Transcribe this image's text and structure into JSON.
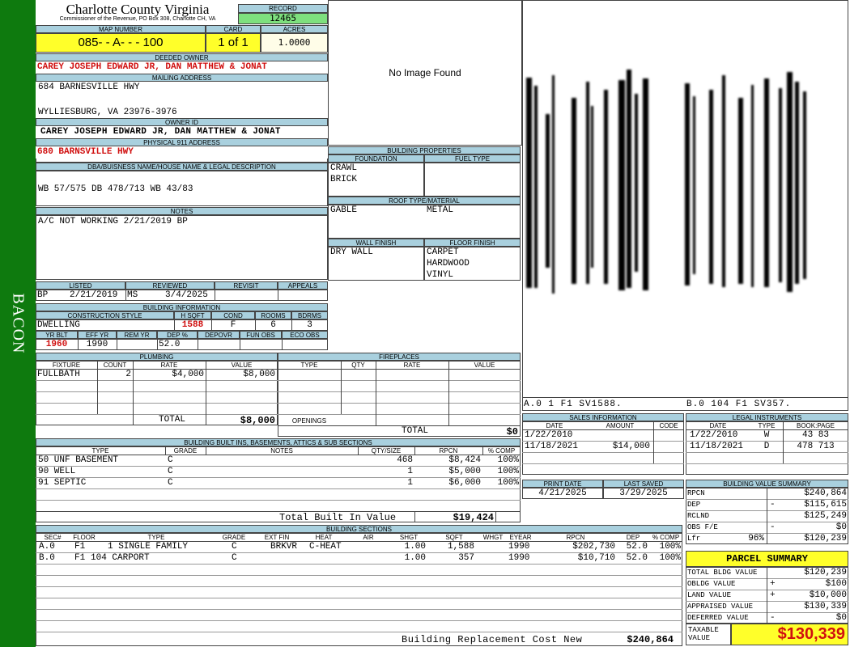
{
  "sidebar_label": "BACON",
  "county": {
    "name": "Charlotte County Virginia",
    "sub": "Commissioner of the Revenue, PO Box 308, Charlotte CH, VA"
  },
  "record": {
    "label": "RECORD",
    "value": "12465"
  },
  "map": {
    "label": "MAP NUMBER",
    "value": "085- - A- - - 100"
  },
  "card": {
    "label": "CARD",
    "value": "1 of 1"
  },
  "acres": {
    "label": "ACRES",
    "value": "1.0000"
  },
  "deeded_owner": {
    "label": "DEEDED OWNER",
    "value": "CAREY JOSEPH EDWARD JR, DAN MATTHEW & JONAT"
  },
  "mailing": {
    "label": "MAILING ADDRESS",
    "line1": "684 BARNESVILLE HWY",
    "line2": "WYLLIESBURG, VA 23976-3976"
  },
  "owner_id": {
    "label": "OWNER ID",
    "value": "CAREY JOSEPH EDWARD JR, DAN MATTHEW & JONAT"
  },
  "address911": {
    "label": "PHYSICAL 911 ADDRESS",
    "value": "680 BARNSVILLE HWY"
  },
  "legal": {
    "label": "DBA/BUISNESS NAME/HOUSE NAME & LEGAL DESCRIPTION",
    "value": "WB 57/575 DB 478/713 WB 43/83"
  },
  "notes": {
    "label": "NOTES",
    "value": "A/C NOT WORKING 2/21/2019 BP"
  },
  "image": {
    "text": "No Image Found"
  },
  "sketch": {
    "caption_a": "A.0 1 F1 SV1588.",
    "caption_b": "B.0 104 F1 SV357."
  },
  "listed": {
    "labels": [
      "LISTED",
      "REVIEWED",
      "REVISIT",
      "APPEALS"
    ],
    "listed_by": "BP",
    "listed_date": "2/21/2019",
    "reviewed_by": "MS",
    "reviewed_date": "3/4/2025"
  },
  "building_info": {
    "label": "BUILDING INFORMATION",
    "labels": [
      "CONSTRUCTION STYLE",
      "H SQFT",
      "COND",
      "ROOMS",
      "BDRMS"
    ],
    "style": "DWELLING",
    "hsqft": "1588",
    "cond": "F",
    "rooms": "6",
    "bdrms": "3",
    "labels2": [
      "YR BLT",
      "EFF YR",
      "REM YR",
      "DEP %",
      "DEPOVR",
      "FUN OBS",
      "ECO OBS"
    ],
    "yr_blt": "1960",
    "eff_yr": "1990",
    "dep": "52.0"
  },
  "building_props": {
    "label": "BUILDING PROPERTIES",
    "foundation_label": "FOUNDATION",
    "fuel_label": "FUEL TYPE",
    "foundation": [
      "CRAWL",
      "BRICK"
    ],
    "roof_label": "ROOF TYPE/MATERIAL",
    "roof_type": "GABLE",
    "roof_material": "METAL",
    "wall_label": "WALL FINISH",
    "floor_label": "FLOOR FINISH",
    "wall": "DRY WALL",
    "floor": [
      "CARPET",
      "HARDWOOD",
      "VINYL"
    ]
  },
  "plumbing": {
    "label": "PLUMBING",
    "headers": [
      "FIXTURE",
      "COUNT",
      "RATE",
      "VALUE"
    ],
    "rows": [
      {
        "fixture": "FULLBATH",
        "count": "2",
        "rate": "$4,000",
        "value": "$8,000"
      }
    ],
    "total_label": "TOTAL",
    "total": "$8,000"
  },
  "fireplaces": {
    "label": "FIREPLACES",
    "headers": [
      "TYPE",
      "QTY",
      "RATE",
      "VALUE"
    ],
    "openings_label": "OPENINGS",
    "total_label": "TOTAL",
    "total": "$0"
  },
  "sales": {
    "label": "SALES INFORMATION",
    "headers": [
      "DATE",
      "AMOUNT",
      "CODE"
    ],
    "rows": [
      {
        "date": "1/22/2010",
        "amount": "",
        "code": ""
      },
      {
        "date": "11/18/2021",
        "amount": "$14,000",
        "code": ""
      }
    ]
  },
  "legal_instruments": {
    "label": "LEGAL INSTRUMENTS",
    "headers": [
      "DATE",
      "TYPE",
      "BOOK:PAGE"
    ],
    "rows": [
      {
        "date": "1/22/2010",
        "type": "W",
        "book": "43 83"
      },
      {
        "date": "11/18/2021",
        "type": "D",
        "book": "478 713"
      }
    ]
  },
  "builtins": {
    "label": "BUILDING BUILT INS, BASEMENTS, ATTICS & SUB SECTIONS",
    "headers": [
      "TYPE",
      "GRADE",
      "NOTES",
      "QTY/SIZE",
      "RPCN",
      "% COMP"
    ],
    "rows": [
      {
        "type": "50 UNF BASEMENT",
        "grade": "C",
        "notes": "",
        "qty": "468",
        "rpcn": "$8,424",
        "comp": "100%"
      },
      {
        "type": "90 WELL",
        "grade": "C",
        "notes": "",
        "qty": "1",
        "rpcn": "$5,000",
        "comp": "100%"
      },
      {
        "type": "91 SEPTIC",
        "grade": "C",
        "notes": "",
        "qty": "1",
        "rpcn": "$6,000",
        "comp": "100%"
      }
    ],
    "total_label": "Total Built In Value",
    "total": "$19,424"
  },
  "print": {
    "print_label": "PRINT DATE",
    "print_date": "4/21/2025",
    "saved_label": "LAST SAVED",
    "saved_date": "3/29/2025"
  },
  "bvs": {
    "label": "BUILDING VALUE SUMMARY",
    "rows": [
      {
        "k": "RPCN",
        "sign": "",
        "v": "$240,864"
      },
      {
        "k": "DEP",
        "sign": "-",
        "v": "$115,615"
      },
      {
        "k": "RCLND",
        "sign": "",
        "v": "$125,249"
      },
      {
        "k": "OBS F/E",
        "sign": "-",
        "v": "$0"
      },
      {
        "k": "Lfr",
        "pct": "96%",
        "sign": "",
        "v": "$120,239"
      }
    ]
  },
  "parcel": {
    "label": "PARCEL SUMMARY",
    "rows": [
      {
        "k": "TOTAL BLDG VALUE",
        "sign": "",
        "v": "$120,239"
      },
      {
        "k": "OBLDG VALUE",
        "sign": "+",
        "v": "$100"
      },
      {
        "k": "LAND VALUE",
        "sign": "+",
        "v": "$10,000"
      },
      {
        "k": "APPRAISED VALUE",
        "sign": "",
        "v": "$130,339"
      },
      {
        "k": "DEFERRED VALUE",
        "sign": "-",
        "v": "$0"
      }
    ],
    "taxable_label": "TAXABLE VALUE",
    "taxable": "$130,339"
  },
  "sections": {
    "label": "BUILDING SECTIONS",
    "headers": [
      "SEC#",
      "FLOOR",
      "TYPE",
      "GRADE",
      "EXT FIN",
      "HEAT",
      "AIR",
      "SHGT",
      "SQFT",
      "WHGT",
      "EYEAR",
      "RPCN",
      "DEP",
      "% COMP"
    ],
    "rows": [
      {
        "sec": "A.0",
        "floor": "F1",
        "type": "1 SINGLE FAMILY",
        "grade": "C",
        "ext": "BRKVR",
        "heat": "C-HEAT",
        "air": "",
        "shgt": "1.00",
        "sqft": "1,588",
        "whgt": "",
        "eyear": "1990",
        "rpcn": "$202,730",
        "dep": "52.0",
        "comp": "100%"
      },
      {
        "sec": "B.0",
        "floor": "F1",
        "type": "104 CARPORT",
        "grade": "C",
        "ext": "",
        "heat": "",
        "air": "",
        "shgt": "1.00",
        "sqft": "357",
        "whgt": "",
        "eyear": "1990",
        "rpcn": "$10,710",
        "dep": "52.0",
        "comp": "100%"
      }
    ],
    "total_label": "Building Replacement Cost New",
    "total": "$240,864"
  }
}
